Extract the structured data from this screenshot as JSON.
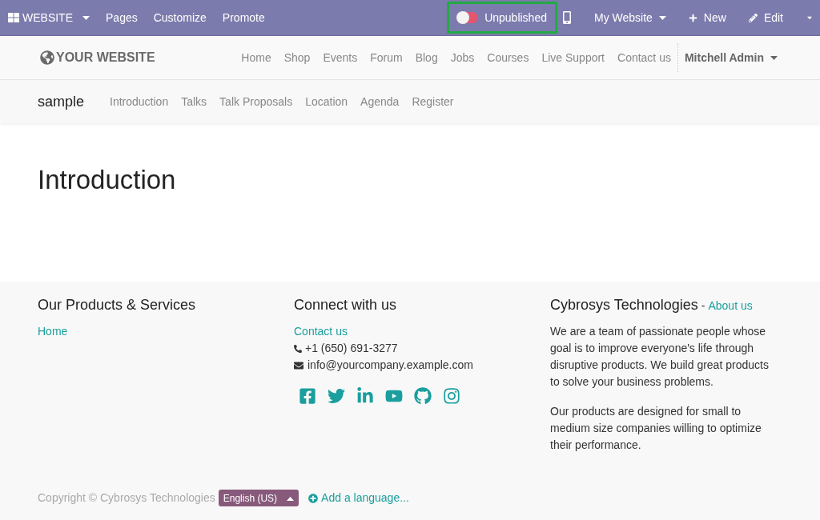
{
  "admin_bar": {
    "app_menu": "WEBSITE",
    "menu": [
      "Pages",
      "Customize",
      "Promote"
    ],
    "publish_toggle": {
      "label": "Unpublished",
      "published": false,
      "highlighted": true
    },
    "website_menu": "My Website",
    "new_button": "New",
    "edit_button": "Edit"
  },
  "header": {
    "logo": "YOUR WEBSITE",
    "nav": [
      "Home",
      "Shop",
      "Events",
      "Forum",
      "Blog",
      "Jobs",
      "Courses",
      "Live Support",
      "Contact us"
    ],
    "user": "Mitchell Admin"
  },
  "event_nav": {
    "title": "sample",
    "items": [
      "Introduction",
      "Talks",
      "Talk Proposals",
      "Location",
      "Agenda",
      "Register"
    ]
  },
  "page_title": "Introduction",
  "footer": {
    "col1": {
      "heading": "Our Products & Services",
      "links": [
        "Home"
      ]
    },
    "col2": {
      "heading": "Connect with us",
      "link": "Contact us",
      "phone": "+1 (650) 691-3277",
      "email": "info@yourcompany.example.com",
      "social": [
        {
          "kind": "facebook"
        },
        {
          "kind": "twitter"
        },
        {
          "kind": "linkedin"
        },
        {
          "kind": "youtube"
        },
        {
          "kind": "github"
        },
        {
          "kind": "instagram"
        }
      ]
    },
    "col3": {
      "heading": "Cybrosys Technologies",
      "separator": "-",
      "link": "About us",
      "paragraphs": [
        "We are a team of passionate people whose goal is to improve everyone's life through disruptive products. We build great products to solve your business problems.",
        "Our products are designed for small to medium size companies willing to optimize their performance."
      ]
    },
    "copyright": "Copyright © Cybrosys Technologies",
    "language": "English (US)",
    "add_language": "Add a language..."
  }
}
